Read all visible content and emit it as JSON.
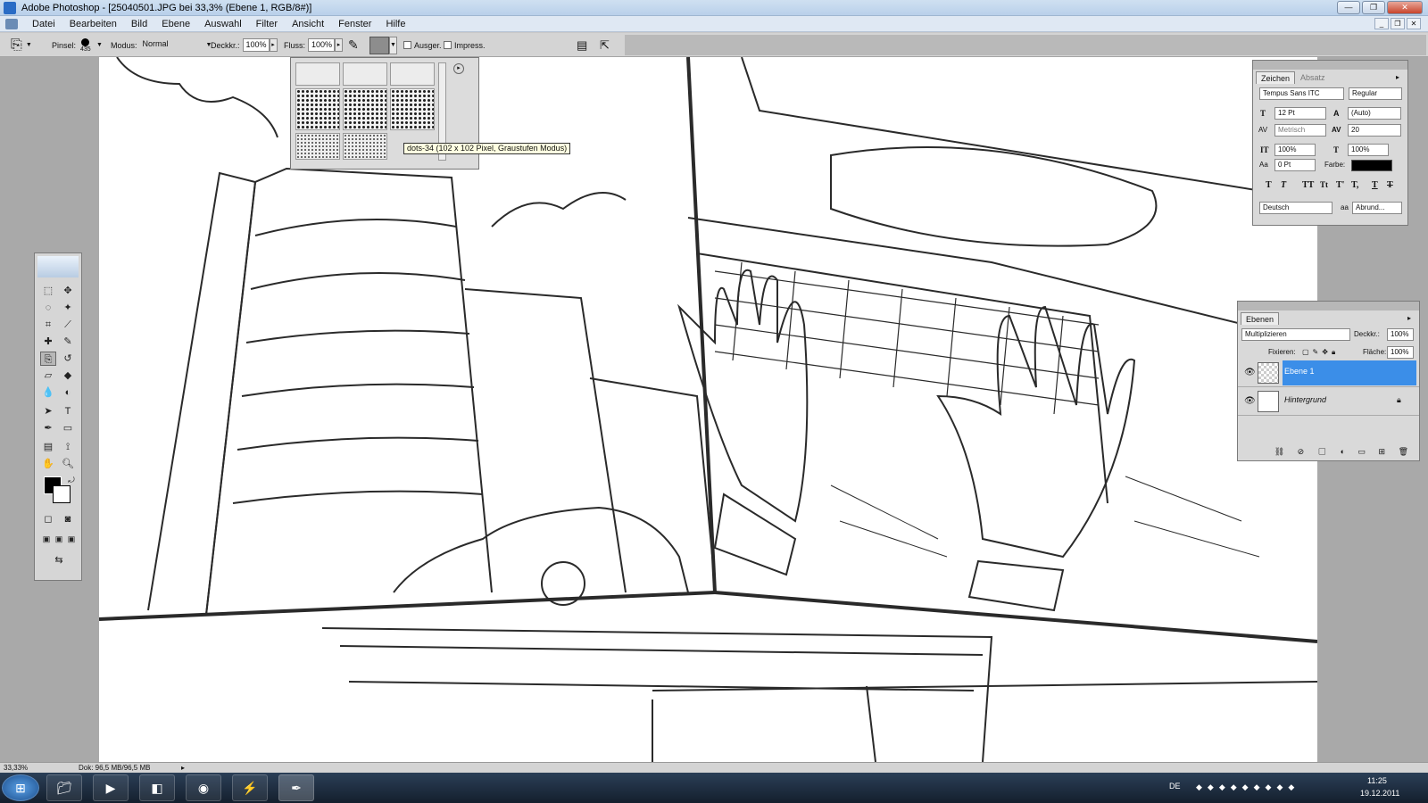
{
  "window": {
    "title": "Adobe Photoshop - [25040501.JPG bei 33,3% (Ebene 1, RGB/8#)]"
  },
  "menu": [
    "Datei",
    "Bearbeiten",
    "Bild",
    "Ebene",
    "Auswahl",
    "Filter",
    "Ansicht",
    "Fenster",
    "Hilfe"
  ],
  "options": {
    "brush_label": "Pinsel:",
    "brush_size": "435",
    "mode_label": "Modus:",
    "mode_value": "Normal",
    "opacity_label": "Deckkr.:",
    "opacity_value": "100%",
    "flow_label": "Fluss:",
    "flow_value": "100%",
    "aligned_label": "Ausger.",
    "impress_label": "Impress."
  },
  "pattern_picker": {
    "tooltip": "dots-34 (102 x 102 Pixel, Graustufen Modus)"
  },
  "character_panel": {
    "tabs": [
      "Zeichen",
      "Absatz"
    ],
    "font_family": "Tempus Sans ITC",
    "font_style": "Regular",
    "font_size": "12 Pt",
    "leading": "(Auto)",
    "kerning": "Metrisch",
    "tracking": "20",
    "vertical_scale": "100%",
    "horizontal_scale": "100%",
    "baseline_shift": "0 Pt",
    "color_label": "Farbe:",
    "color": "#000000",
    "style_buttons": [
      "T",
      "T",
      "TT",
      "Tt",
      "T'",
      "T,",
      "T",
      "T"
    ],
    "language": "Deutsch",
    "antialias_icon": "aa",
    "antialias": "Abrund..."
  },
  "layers_panel": {
    "tab": "Ebenen",
    "blend_mode": "Multiplizieren",
    "opacity_label": "Deckkr.:",
    "opacity": "100%",
    "lock_label": "Fixieren:",
    "fill_label": "Fläche:",
    "fill": "100%",
    "layers": [
      {
        "name": "Ebene 1",
        "selected": true
      },
      {
        "name": "Hintergrund",
        "selected": false
      }
    ]
  },
  "status": {
    "zoom": "33,33%",
    "doc_info": "Dok: 96,5 MB/96,5 MB"
  },
  "taskbar": {
    "language": "DE",
    "time": "11:25",
    "date": "19.12.2011"
  },
  "colors": {
    "selection": "#3b8ee8",
    "foreground": "#000000",
    "background": "#ffffff"
  }
}
